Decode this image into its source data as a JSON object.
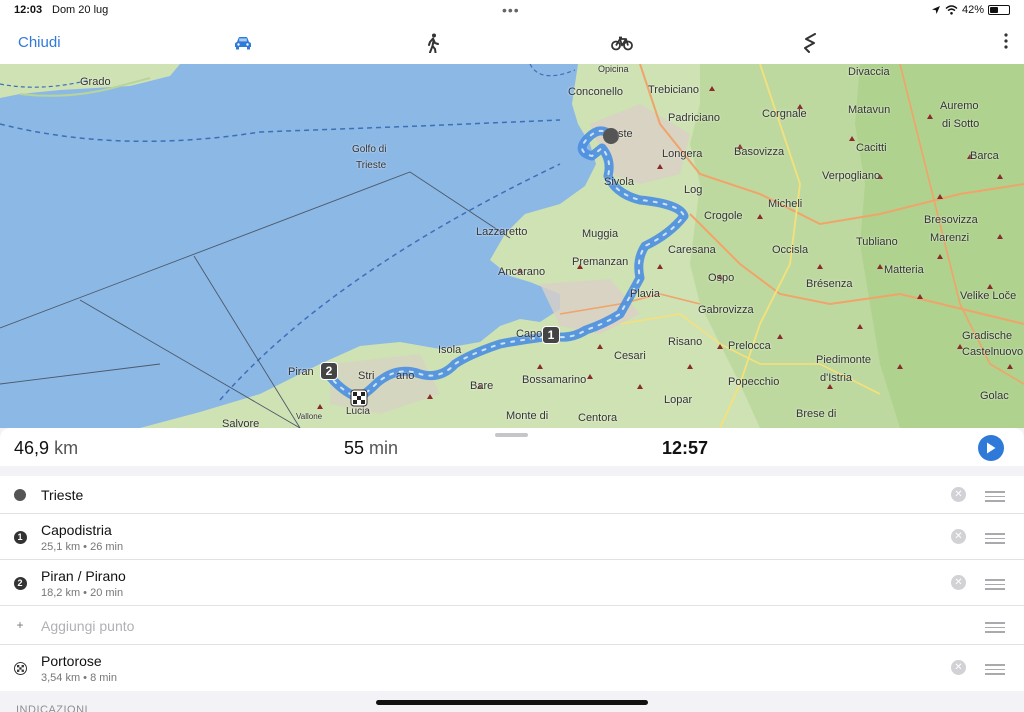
{
  "status": {
    "time": "12:03",
    "date": "Dom 20 lug",
    "battery": "42%",
    "battery_level": 0.42,
    "icons": [
      "location-arrow-icon",
      "wifi-icon",
      "battery-icon"
    ]
  },
  "toolbar": {
    "close_label": "Chiudi",
    "modes": [
      {
        "name": "car",
        "icon": "car-icon",
        "active": true
      },
      {
        "name": "walk",
        "icon": "walk-icon",
        "active": false
      },
      {
        "name": "bike",
        "icon": "bike-icon",
        "active": false
      },
      {
        "name": "hiking",
        "icon": "zigzag-icon",
        "active": false
      }
    ],
    "accent": "#2f7ad8"
  },
  "map": {
    "labels": [
      "Grado",
      "Golfo di",
      "Trieste",
      "Conconello",
      "Trebiciano",
      "Padriciano",
      "Corgnale",
      "Divaccia",
      "Matavun",
      "Auremo",
      "di Sotto",
      "Longera",
      "Basovizza",
      "Cacitti",
      "Barca",
      "Verpogliano",
      "Log",
      "Crogole",
      "Micheli",
      "Bresovizza",
      "Marenzi",
      "Lazzaretto",
      "Muggia",
      "Caresana",
      "Occisla",
      "Tubliano",
      "Ancarano",
      "Premanzan",
      "Ospo",
      "Matteria",
      "Plavia",
      "Brésenza",
      "Velike Loče",
      "Gabrovizza",
      "Gradische",
      "Castelnuovo",
      "Capo",
      "Cesari",
      "Risano",
      "Prelocca",
      "Piedimonte",
      "d'Istria",
      "Isola",
      "Bossamarino",
      "Popecchio",
      "Piran",
      "Stri",
      "ano",
      "Bare",
      "Lopar",
      "Golac",
      "Monte di",
      "Centora",
      "Brese di",
      "Vallone",
      "Lucia",
      "Salvore",
      "Opicina",
      "ste",
      "Sivola"
    ],
    "route_color": "#4a8fe0",
    "water_color": "#8cb8e6",
    "land_color": "#cfe2b4",
    "markers": [
      {
        "label": "1"
      },
      {
        "label": "2"
      }
    ]
  },
  "summary": {
    "distance_value": "46,9",
    "distance_unit": "km",
    "duration_value": "55",
    "duration_unit": "min",
    "eta": "12:57"
  },
  "waypoints": [
    {
      "kind": "start",
      "title": "Trieste",
      "sub": ""
    },
    {
      "kind": "stop",
      "number": "1",
      "title": "Capodistria",
      "sub": "25,1 km • 26 min"
    },
    {
      "kind": "stop",
      "number": "2",
      "title": "Piran / Pirano",
      "sub": "18,2 km • 20 min"
    },
    {
      "kind": "add",
      "symbol": "+",
      "title": "Aggiungi punto",
      "sub": ""
    },
    {
      "kind": "finish",
      "title": "Portorose",
      "sub": "3,54 km • 8 min"
    }
  ],
  "directions_label": "INDICAZIONI"
}
